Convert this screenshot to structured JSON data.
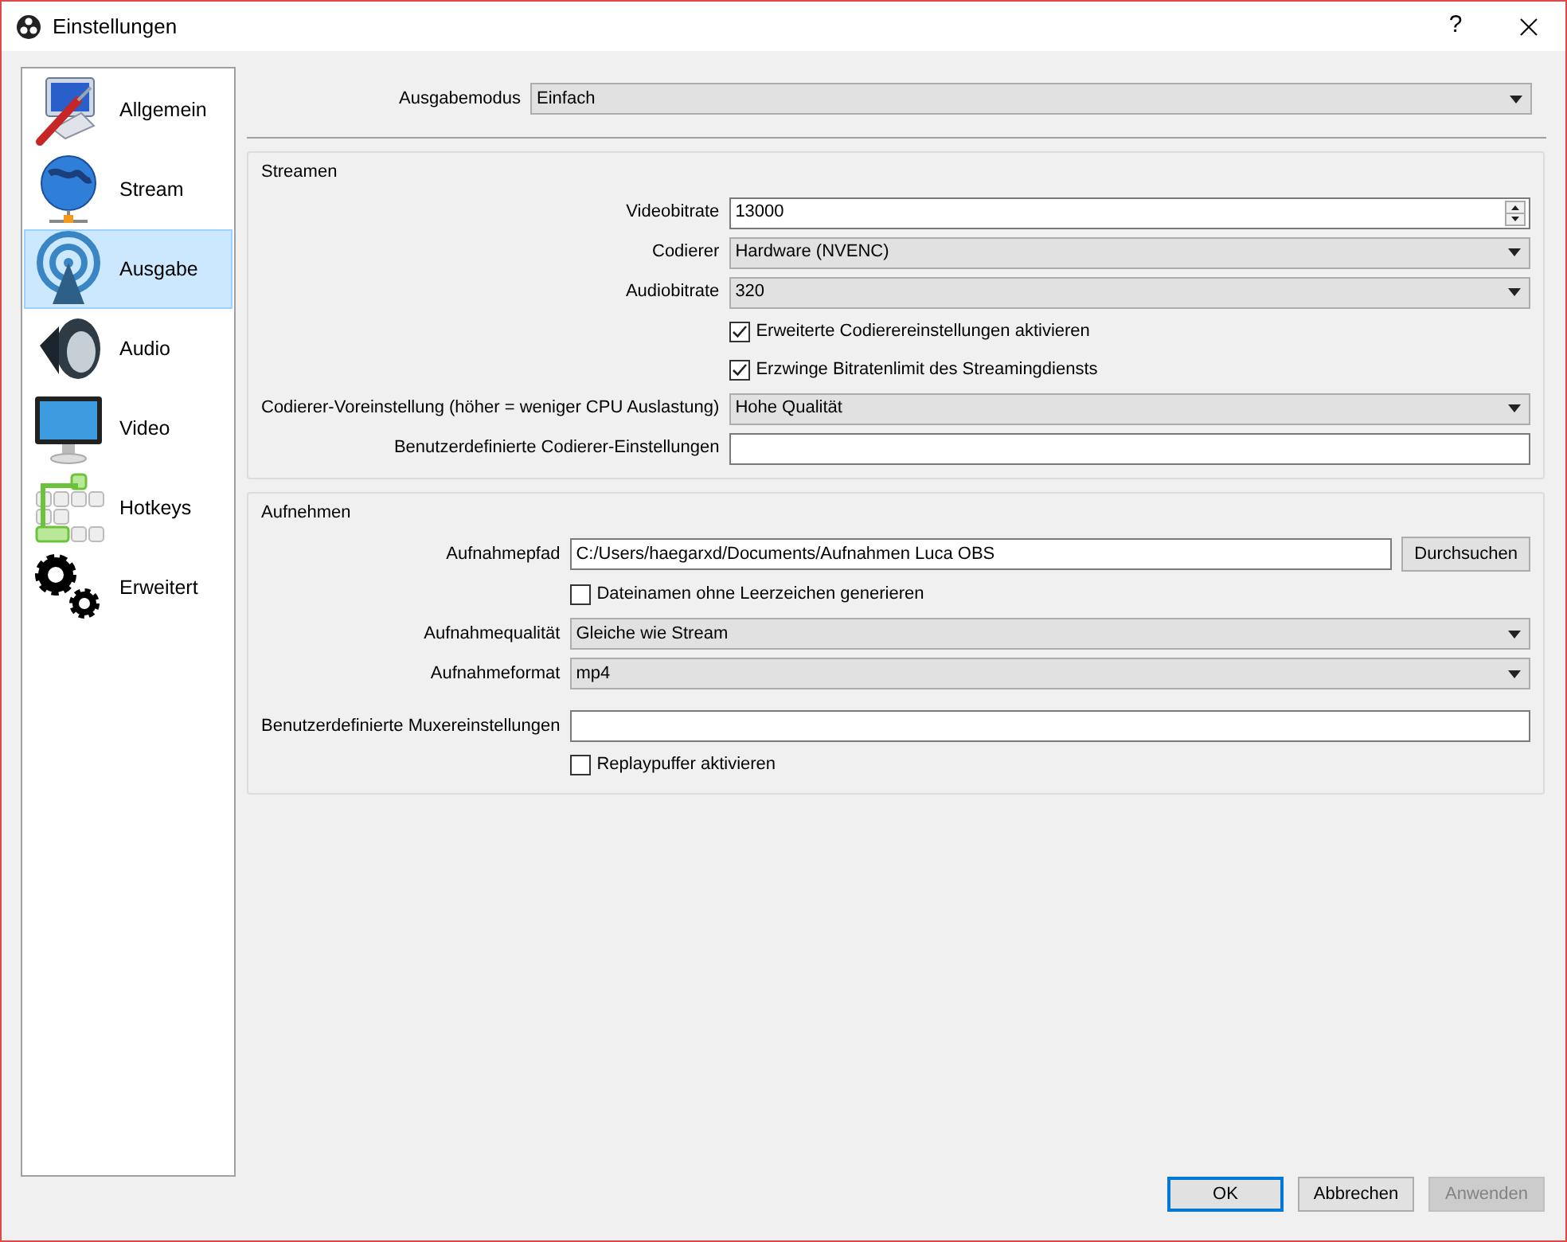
{
  "window": {
    "title": "Einstellungen",
    "help": "?"
  },
  "sidebar": {
    "items": [
      {
        "label": "Allgemein",
        "selected": false
      },
      {
        "label": "Stream",
        "selected": false
      },
      {
        "label": "Ausgabe",
        "selected": true
      },
      {
        "label": "Audio",
        "selected": false
      },
      {
        "label": "Video",
        "selected": false
      },
      {
        "label": "Hotkeys",
        "selected": false
      },
      {
        "label": "Erweitert",
        "selected": false
      }
    ]
  },
  "output_mode": {
    "label": "Ausgabemodus",
    "value": "Einfach"
  },
  "groups": [
    {
      "title": "Streamen",
      "fields": [
        {
          "kind": "spin",
          "label": "Videobitrate",
          "value": "13000"
        },
        {
          "kind": "combo",
          "label": "Codierer",
          "value": "Hardware (NVENC)"
        },
        {
          "kind": "combo",
          "label": "Audiobitrate",
          "value": "320"
        },
        {
          "kind": "checkbox",
          "label": "Erweiterte Codierereinstellungen aktivieren",
          "checked": true
        },
        {
          "kind": "checkbox",
          "label": "Erzwinge Bitratenlimit des Streamingdiensts",
          "checked": true
        },
        {
          "kind": "combo",
          "label": "Codierer-Voreinstellung (höher = weniger CPU Auslastung)",
          "value": "Hohe Qualität"
        },
        {
          "kind": "text",
          "label": "Benutzerdefinierte Codierer-Einstellungen"
        }
      ]
    },
    {
      "title": "Aufnehmen",
      "fields": [
        {
          "kind": "path",
          "label": "Aufnahmepfad",
          "value": "C:/Users/haegarxd/Documents/Aufnahmen Luca OBS",
          "button": "Durchsuchen"
        },
        {
          "kind": "checkbox",
          "label": "Dateinamen ohne Leerzeichen generieren",
          "checked": false
        },
        {
          "kind": "combo",
          "label": "Aufnahmequalität",
          "value": "Gleiche wie Stream"
        },
        {
          "kind": "combo",
          "label": "Aufnahmeformat",
          "value": "mp4"
        },
        {
          "kind": "text",
          "label": "Benutzerdefinierte Muxereinstellungen"
        },
        {
          "kind": "checkbox",
          "label": "Replaypuffer aktivieren",
          "checked": false
        }
      ]
    }
  ],
  "buttons": [
    {
      "label": "OK",
      "kind": "default",
      "disabled": false
    },
    {
      "label": "Abbrechen",
      "kind": "normal",
      "disabled": false
    },
    {
      "label": "Anwenden",
      "kind": "normal",
      "disabled": true
    }
  ]
}
